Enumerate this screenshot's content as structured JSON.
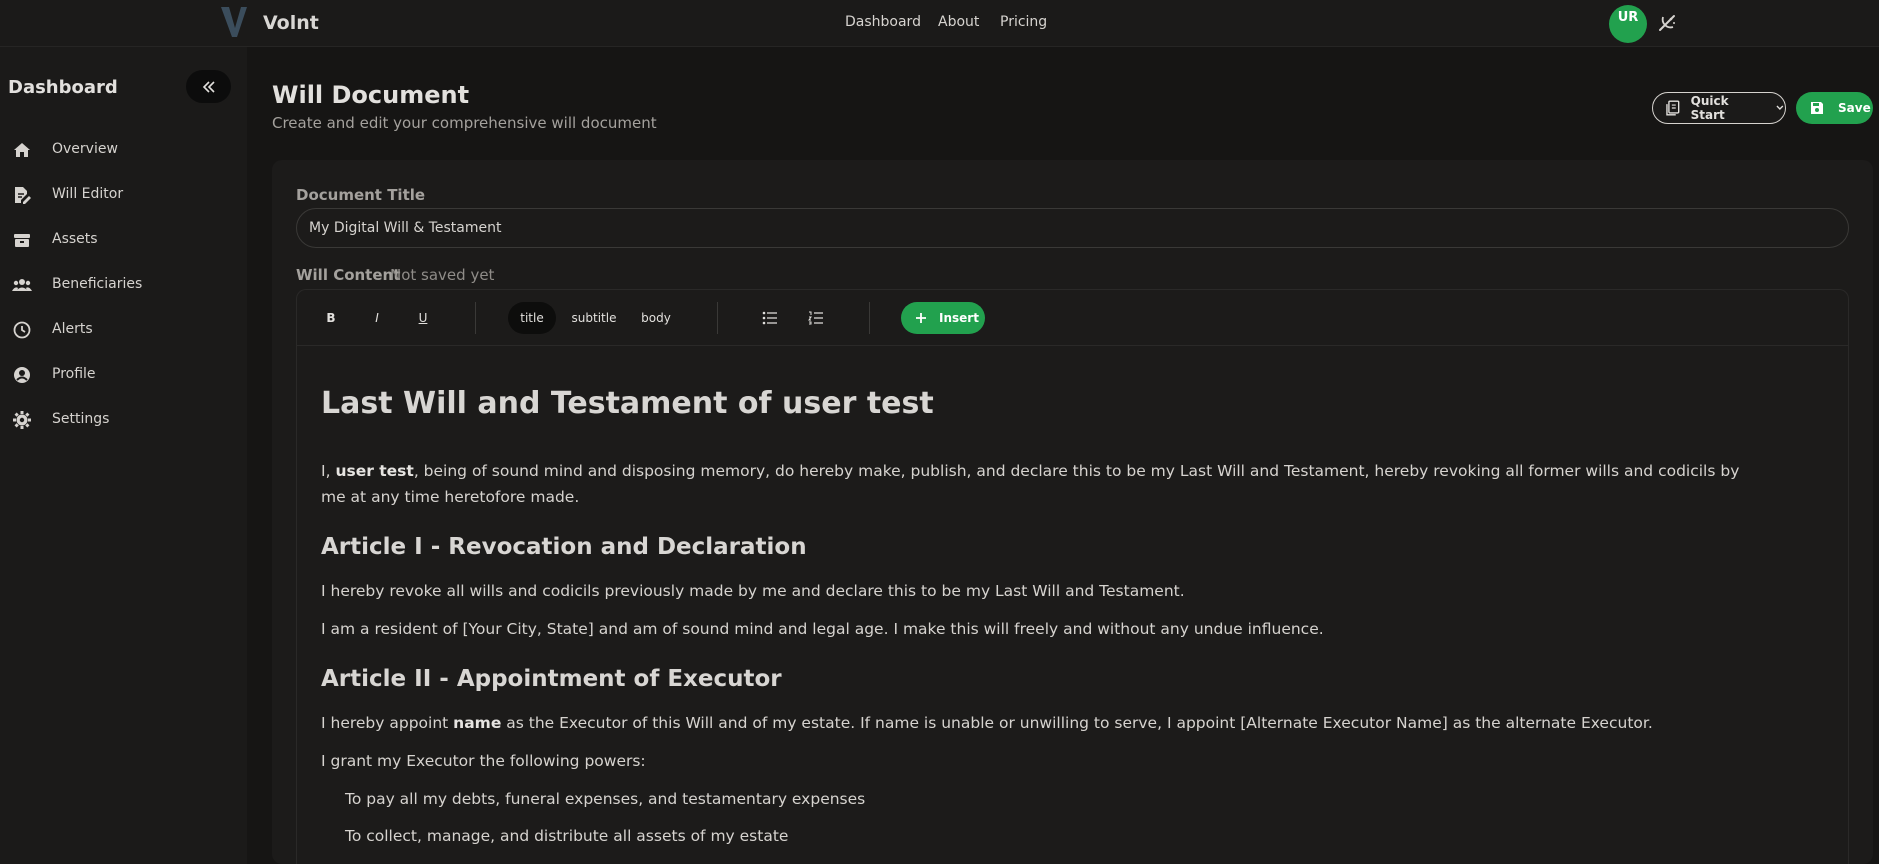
{
  "app": {
    "name": "Volnt",
    "avatar_initials": "UR"
  },
  "nav": {
    "dashboard": "Dashboard",
    "about": "About",
    "pricing": "Pricing"
  },
  "sidebar": {
    "title": "Dashboard",
    "items": [
      {
        "label": "Overview",
        "icon": "home-icon"
      },
      {
        "label": "Will Editor",
        "icon": "document-edit-icon"
      },
      {
        "label": "Assets",
        "icon": "archive-icon"
      },
      {
        "label": "Beneficiaries",
        "icon": "users-icon"
      },
      {
        "label": "Alerts",
        "icon": "clock-icon"
      },
      {
        "label": "Profile",
        "icon": "user-circle-icon"
      },
      {
        "label": "Settings",
        "icon": "gear-icon"
      }
    ]
  },
  "header": {
    "title": "Will Document",
    "subtitle": "Create and edit your comprehensive will document",
    "quick_start_label": "Quick Start",
    "save_label": "Save"
  },
  "form": {
    "document_title_label": "Document Title",
    "document_title_value": "My Digital Will & Testament",
    "content_label": "Will Content",
    "save_status": "Not saved yet"
  },
  "toolbar": {
    "bold": "B",
    "italic": "I",
    "underline": "U",
    "styles": [
      "title",
      "subtitle",
      "body"
    ],
    "active_style": "title",
    "insert_label": "Insert"
  },
  "document": {
    "heading": "Last Will and Testament of user test",
    "intro_prefix": "I, ",
    "intro_name": "user test",
    "intro_rest": ", being of sound mind and disposing memory, do hereby make, publish, and declare this to be my Last Will and Testament, hereby revoking all former wills and codicils by me at any time heretofore made.",
    "article1_title": "Article I - Revocation and Declaration",
    "article1_p1": "I hereby revoke all wills and codicils previously made by me and declare this to be my Last Will and Testament.",
    "article1_p2": "I am a resident of [Your City, State] and am of sound mind and legal age. I make this will freely and without any undue influence.",
    "article2_title": "Article II - Appointment of Executor",
    "article2_p1_prefix": "I hereby appoint ",
    "article2_p1_name": "name",
    "article2_p1_rest": " as the Executor of this Will and of my estate. If name is unable or unwilling to serve, I appoint [Alternate Executor Name] as the alternate Executor.",
    "article2_p2": "I grant my Executor the following powers:",
    "powers": [
      "To pay all my debts, funeral expenses, and testamentary expenses",
      "To collect, manage, and distribute all assets of my estate"
    ]
  },
  "colors": {
    "accent": "#22a14e",
    "background": "#161514",
    "panel": "#1b1a19"
  }
}
